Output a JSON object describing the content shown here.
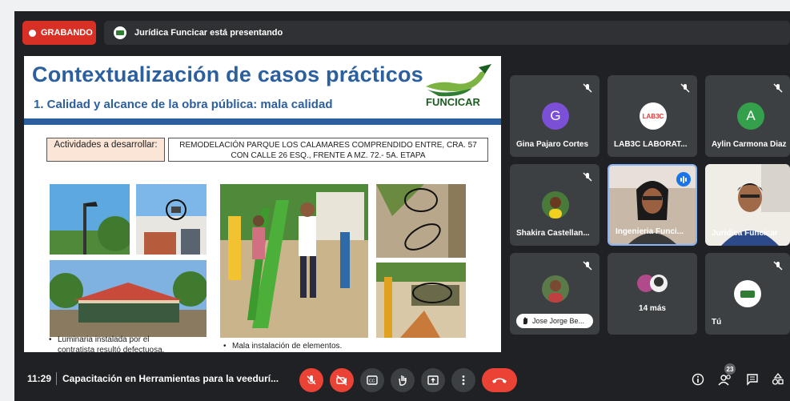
{
  "recording": {
    "label": "GRABANDO"
  },
  "presenter": {
    "text": "Jurídica Funcicar está presentando"
  },
  "slide": {
    "title": "Contextualización de casos prácticos",
    "subtitle": "1. Calidad y alcance de la obra pública: mala calidad",
    "brand": "FUNCICAR",
    "activities_label": "Actividades a desarrollar:",
    "description": "REMODELACIÓN PARQUE LOS CALAMARES COMPRENDIDO ENTRE, CRA. 57 CON CALLE 26 ESQ., FRENTE A MZ. 72.- 5A. ETAPA",
    "caption_left": "Luminaria instalada por el contratista resultó defectuosa.",
    "caption_mid": "Mala instalación de elementos."
  },
  "participants": [
    {
      "name": "Gina Pajaro Cortes",
      "initial": "G",
      "color": "#7b4fd6"
    },
    {
      "name": "LAB3C LABORAT...",
      "logo": "LAB3C"
    },
    {
      "name": "Aylin Carmona Diaz",
      "initial": "A",
      "color": "#35a04c"
    },
    {
      "name": "Shakira Castellan..."
    },
    {
      "name": "Ingenieria Funci..."
    },
    {
      "name": "Juridica Funcicar"
    },
    {
      "name": "Jose Jorge Be..."
    },
    {
      "name": "14 más"
    },
    {
      "name": "Tú"
    }
  ],
  "bottom": {
    "time": "11:29",
    "meeting_title": "Capacitación en Herramientas para la veedurí...",
    "participant_count": "23"
  },
  "icons": {
    "mic_off": "mic-off-icon",
    "cam_off": "camera-off-icon",
    "captions": "captions-icon",
    "hand": "raise-hand-icon",
    "present": "present-icon",
    "more": "more-vert-icon",
    "end": "end-call-icon",
    "info": "info-icon",
    "people": "people-icon",
    "chat": "chat-icon",
    "activities": "activities-icon"
  },
  "colors": {
    "record_red": "#d93025",
    "slide_blue": "#2c5f9e",
    "end_red": "#ea4335",
    "speaking_blue": "#1a73e8"
  }
}
